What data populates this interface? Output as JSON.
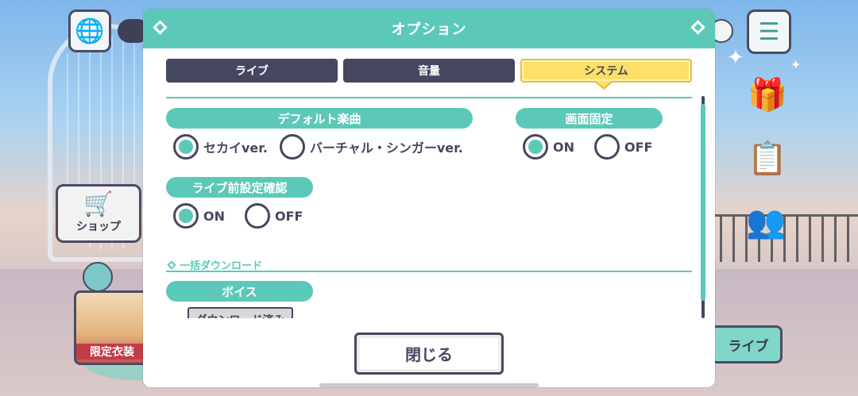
{
  "dialog": {
    "title": "オプション",
    "close_label": "閉じる"
  },
  "tabs": [
    {
      "label": "ライブ",
      "active": false
    },
    {
      "label": "音量",
      "active": false
    },
    {
      "label": "システム",
      "active": true
    }
  ],
  "settings": {
    "default_song": {
      "label": "デフォルト楽曲",
      "options": [
        {
          "label": "セカイver.",
          "selected": true
        },
        {
          "label": "バーチャル・シンガーver.",
          "selected": false
        }
      ]
    },
    "screen_lock": {
      "label": "画面固定",
      "options": [
        {
          "label": "ON",
          "selected": true
        },
        {
          "label": "OFF",
          "selected": false
        }
      ]
    },
    "pre_live_confirm": {
      "label": "ライブ前設定確認",
      "options": [
        {
          "label": "ON",
          "selected": true
        },
        {
          "label": "OFF",
          "selected": false
        }
      ]
    },
    "bulk_download": {
      "heading": "一括ダウンロード",
      "voice_label": "ボイス",
      "voice_button": "ダウンロード済み"
    }
  },
  "background": {
    "shop_label": "ショップ",
    "live_label": "ライブ",
    "banner_text": "限定衣装"
  },
  "colors": {
    "accent": "#5cc9b8",
    "dark": "#45475f",
    "active_tab": "#fde06a"
  }
}
